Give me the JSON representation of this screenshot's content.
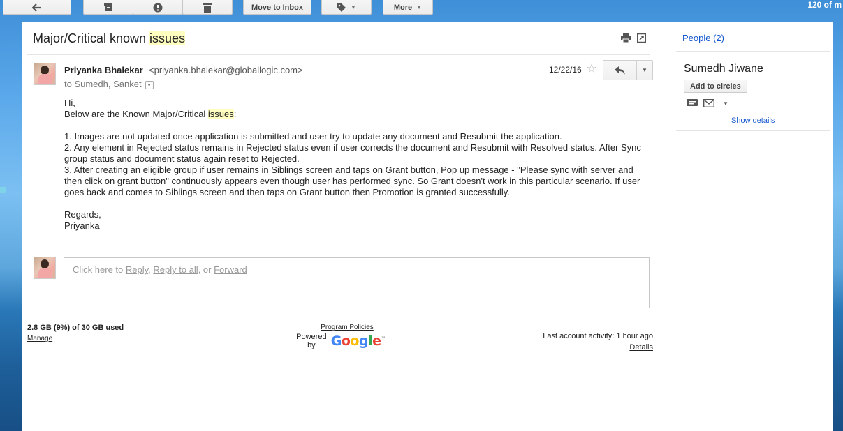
{
  "toolbar": {
    "move_to_inbox_label": "Move to Inbox",
    "more_label": "More",
    "count_label": "120 of m"
  },
  "email": {
    "subject_prefix": "Major/Critical known ",
    "subject_highlight": "issues",
    "sender_name": "Priyanka Bhalekar",
    "sender_email": "<priyanka.bhalekar@globallogic.com>",
    "recipients": "to Sumedh, Sanket",
    "date": "12/22/16",
    "body": {
      "greeting": "Hi,",
      "intro_prefix": "Below are the Known Major/Critical ",
      "intro_highlight": "issues",
      "intro_suffix": ":",
      "item1": "1. Images are not updated once application is submitted and user try to update any document and Resubmit the application.",
      "item2": "2. Any element in Rejected status remains in Rejected status even if user corrects the document and Resubmit with Resolved status. After Sync group status and document status again reset to Rejected.",
      "item3": "3. After creating an eligible group if user remains in Siblings screen and taps on Grant button, Pop up message - \"Please sync with server and then click on grant button\" continuously appears even though user has performed sync. So Grant doesn't work in this particular scenario. If user goes back and comes to Siblings screen and then taps on Grant button then Promotion is granted successfully.",
      "closing": "Regards,",
      "signature": "Priyanka"
    }
  },
  "reply_box": {
    "prefix": "Click here to ",
    "reply": "Reply",
    "sep1": ", ",
    "reply_all": "Reply to all",
    "sep2": ", or ",
    "forward": "Forward"
  },
  "footer": {
    "storage": "2.8 GB (9%) of 30 GB used",
    "manage": "Manage",
    "program_policies": "Program Policies",
    "powered_by": "Powered by",
    "google": "Google",
    "trademark": "™",
    "last_activity": "Last account activity: 1 hour ago",
    "details": "Details"
  },
  "people": {
    "header": "People (2)",
    "name": "Sumedh Jiwane",
    "add_to_circles": "Add to circles",
    "show_details": "Show details"
  },
  "colors": {
    "link": "#1155cc",
    "highlight": "#ffffc0"
  }
}
